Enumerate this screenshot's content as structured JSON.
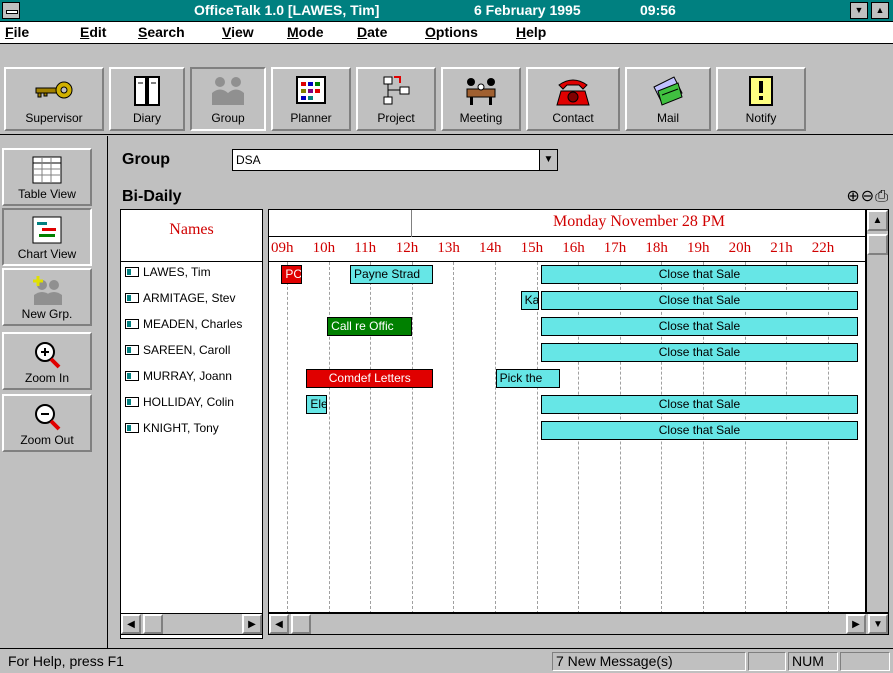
{
  "window": {
    "app_title": "OfficeTalk 1.0 [LAWES, Tim]",
    "date": "6 February 1995",
    "time": "09:56",
    "minimize_glyph": "▼",
    "maximize_glyph": "▲"
  },
  "menu": [
    "File",
    "Edit",
    "Search",
    "View",
    "Mode",
    "Date",
    "Options",
    "Help"
  ],
  "toolbar": [
    {
      "label": "Supervisor",
      "icon": "key-icon"
    },
    {
      "label": "Diary",
      "icon": "diary-icon"
    },
    {
      "label": "Group",
      "icon": "group-icon",
      "pressed": true
    },
    {
      "label": "Planner",
      "icon": "planner-icon"
    },
    {
      "label": "Project",
      "icon": "project-icon"
    },
    {
      "label": "Meeting",
      "icon": "meeting-icon"
    },
    {
      "label": "Contact",
      "icon": "telephone-icon"
    },
    {
      "label": "Mail",
      "icon": "mail-icon"
    },
    {
      "label": "Notify",
      "icon": "notify-icon"
    }
  ],
  "sidebar": [
    {
      "label": "Table View",
      "icon": "table-icon"
    },
    {
      "label": "Chart View",
      "icon": "chart-icon",
      "pressed": true
    },
    {
      "label": "New Grp.",
      "icon": "new-group-icon"
    },
    {
      "label": "Zoom In",
      "icon": "zoom-in-icon"
    },
    {
      "label": "Zoom Out",
      "icon": "zoom-out-icon"
    }
  ],
  "group": {
    "label": "Group",
    "value": "DSA"
  },
  "view": {
    "title": "Bi-Daily",
    "names_header": "Names",
    "date_header": "Monday November 28 PM",
    "hours": [
      "09h",
      "10h",
      "11h",
      "12h",
      "13h",
      "14h",
      "15h",
      "16h",
      "17h",
      "18h",
      "19h",
      "20h",
      "21h",
      "22h"
    ]
  },
  "people": [
    {
      "name": "LAWES, Tim"
    },
    {
      "name": "ARMITAGE, Stev"
    },
    {
      "name": "MEADEN, Charles"
    },
    {
      "name": "SAREEN, Caroll"
    },
    {
      "name": "MURRAY, Joann"
    },
    {
      "name": "HOLLIDAY, Colin"
    },
    {
      "name": "KNIGHT, Tony"
    }
  ],
  "events": [
    {
      "row": 0,
      "label": "PC",
      "start": 9.25,
      "end": 9.75,
      "color": "red"
    },
    {
      "row": 0,
      "label": "Payne Strad",
      "start": 10.9,
      "end": 12.9,
      "color": "cyan"
    },
    {
      "row": 0,
      "label": "Close that Sale",
      "start": 15.5,
      "end": 23.1,
      "color": "cyan"
    },
    {
      "row": 1,
      "label": "Ka",
      "start": 15.0,
      "end": 15.45,
      "color": "cyan"
    },
    {
      "row": 1,
      "label": "Close that Sale",
      "start": 15.5,
      "end": 23.1,
      "color": "cyan"
    },
    {
      "row": 2,
      "label": "Call re Offic",
      "start": 10.35,
      "end": 12.4,
      "color": "green"
    },
    {
      "row": 2,
      "label": "Close that Sale",
      "start": 15.5,
      "end": 23.1,
      "color": "cyan"
    },
    {
      "row": 3,
      "label": "Close that Sale",
      "start": 15.5,
      "end": 23.1,
      "color": "cyan"
    },
    {
      "row": 4,
      "label": "Comdef Letters",
      "start": 9.85,
      "end": 12.9,
      "color": "red"
    },
    {
      "row": 4,
      "label": "Pick the",
      "start": 14.4,
      "end": 15.95,
      "color": "cyan"
    },
    {
      "row": 5,
      "label": "Ele",
      "start": 9.85,
      "end": 10.35,
      "color": "cyan"
    },
    {
      "row": 5,
      "label": "Close that Sale",
      "start": 15.5,
      "end": 23.1,
      "color": "cyan"
    },
    {
      "row": 6,
      "label": "Close that Sale",
      "start": 15.5,
      "end": 23.1,
      "color": "cyan"
    }
  ],
  "statusbar": {
    "help": "For Help, press F1",
    "messages": "7 New Message(s)",
    "num": "NUM"
  },
  "colors": {
    "titlebar": "#008080",
    "header_text": "#d00000",
    "event_cyan": "#66e6e6",
    "event_red": "#e00000",
    "event_green": "#008000"
  }
}
